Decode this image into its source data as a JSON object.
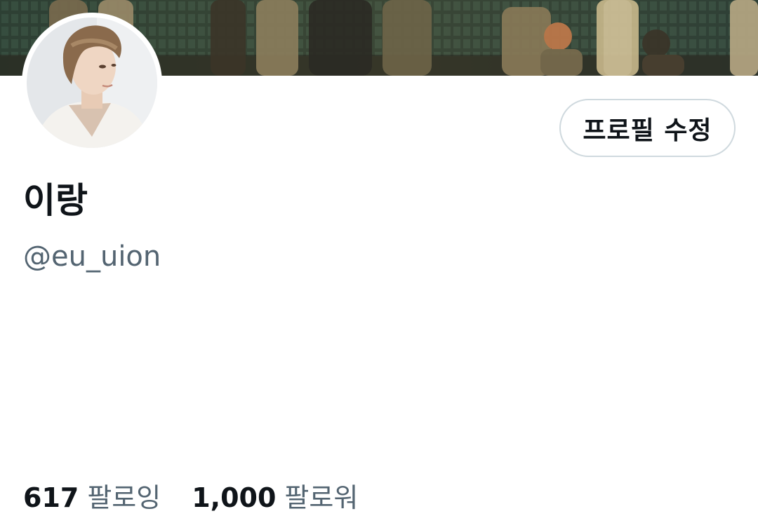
{
  "profile": {
    "display_name": "이랑",
    "handle": "@eu_uion",
    "edit_button_label": "프로필 수정"
  },
  "stats": {
    "following_count": "617",
    "following_label": "팔로잉",
    "followers_count": "1,000",
    "followers_label": "팔로워"
  },
  "colors": {
    "primary_text": "#0f1419",
    "secondary_text": "#536471",
    "button_border": "#cfd9de",
    "background": "#ffffff"
  }
}
